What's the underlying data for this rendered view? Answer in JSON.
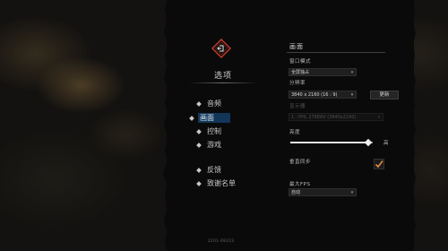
{
  "menu": {
    "title": "选项",
    "items": [
      {
        "label": "音频",
        "selected": false
      },
      {
        "label": "画面",
        "selected": true
      },
      {
        "label": "控制",
        "selected": false
      },
      {
        "label": "游戏",
        "selected": false
      }
    ],
    "secondary_items": [
      {
        "label": "反馈"
      },
      {
        "label": "致谢名单"
      }
    ],
    "version": "2201-69223"
  },
  "settings": {
    "section_title": "画面",
    "window_mode": {
      "label": "窗口模式",
      "value": "全屏独占"
    },
    "resolution": {
      "label": "分辨率",
      "value": "3840 x 2160 (16 : 9)",
      "update_label": "更新"
    },
    "monitor": {
      "label": "显示器",
      "value": "1 - PHL 276E8V (3840x2160)"
    },
    "brightness": {
      "label": "亮度",
      "max_label": "高",
      "level": 0.95
    },
    "vsync": {
      "label": "垂直同步",
      "checked": true
    },
    "max_fps": {
      "label": "最大FPS",
      "value": "自动"
    }
  },
  "colors": {
    "selection_bg": "#123658",
    "panel_bg": "#0a0a0a",
    "logo_red": "#c0392b"
  }
}
